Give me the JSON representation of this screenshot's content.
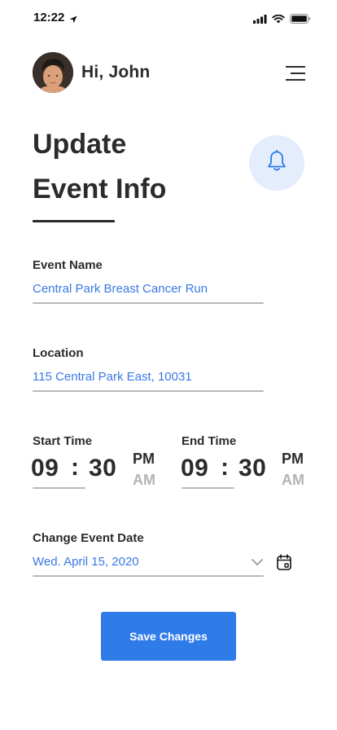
{
  "status_bar": {
    "time": "12:22"
  },
  "header": {
    "greeting": "Hi, John"
  },
  "page": {
    "title_line1": "Update",
    "title_line2": "Event Info"
  },
  "form": {
    "event_name": {
      "label": "Event Name",
      "value": "Central Park Breast Cancer Run"
    },
    "location": {
      "label": "Location",
      "value": "115 Central Park East, 10031"
    },
    "start_time": {
      "label": "Start Time",
      "hour": "09",
      "separator": ":",
      "minute": "30",
      "pm": "PM",
      "am": "AM",
      "selected": "PM"
    },
    "end_time": {
      "label": "End Time",
      "hour": "09",
      "separator": ":",
      "minute": "30",
      "pm": "PM",
      "am": "AM",
      "selected": "PM"
    },
    "event_date": {
      "label": "Change Event Date",
      "value": "Wed. April 15, 2020"
    }
  },
  "actions": {
    "save_label": "Save Changes"
  },
  "icons": {
    "location_arrow": "location-arrow-icon",
    "signal": "cellular-signal-icon",
    "wifi": "wifi-icon",
    "battery": "battery-icon",
    "menu": "hamburger-menu-icon",
    "bell": "bell-icon",
    "chevron": "chevron-down-icon",
    "calendar": "calendar-icon"
  },
  "colors": {
    "accent": "#2f7be8",
    "link_text": "#3a78e4",
    "bell_bg": "#e3edfc",
    "text": "#2b2b2b",
    "muted": "#b3b3b3"
  }
}
